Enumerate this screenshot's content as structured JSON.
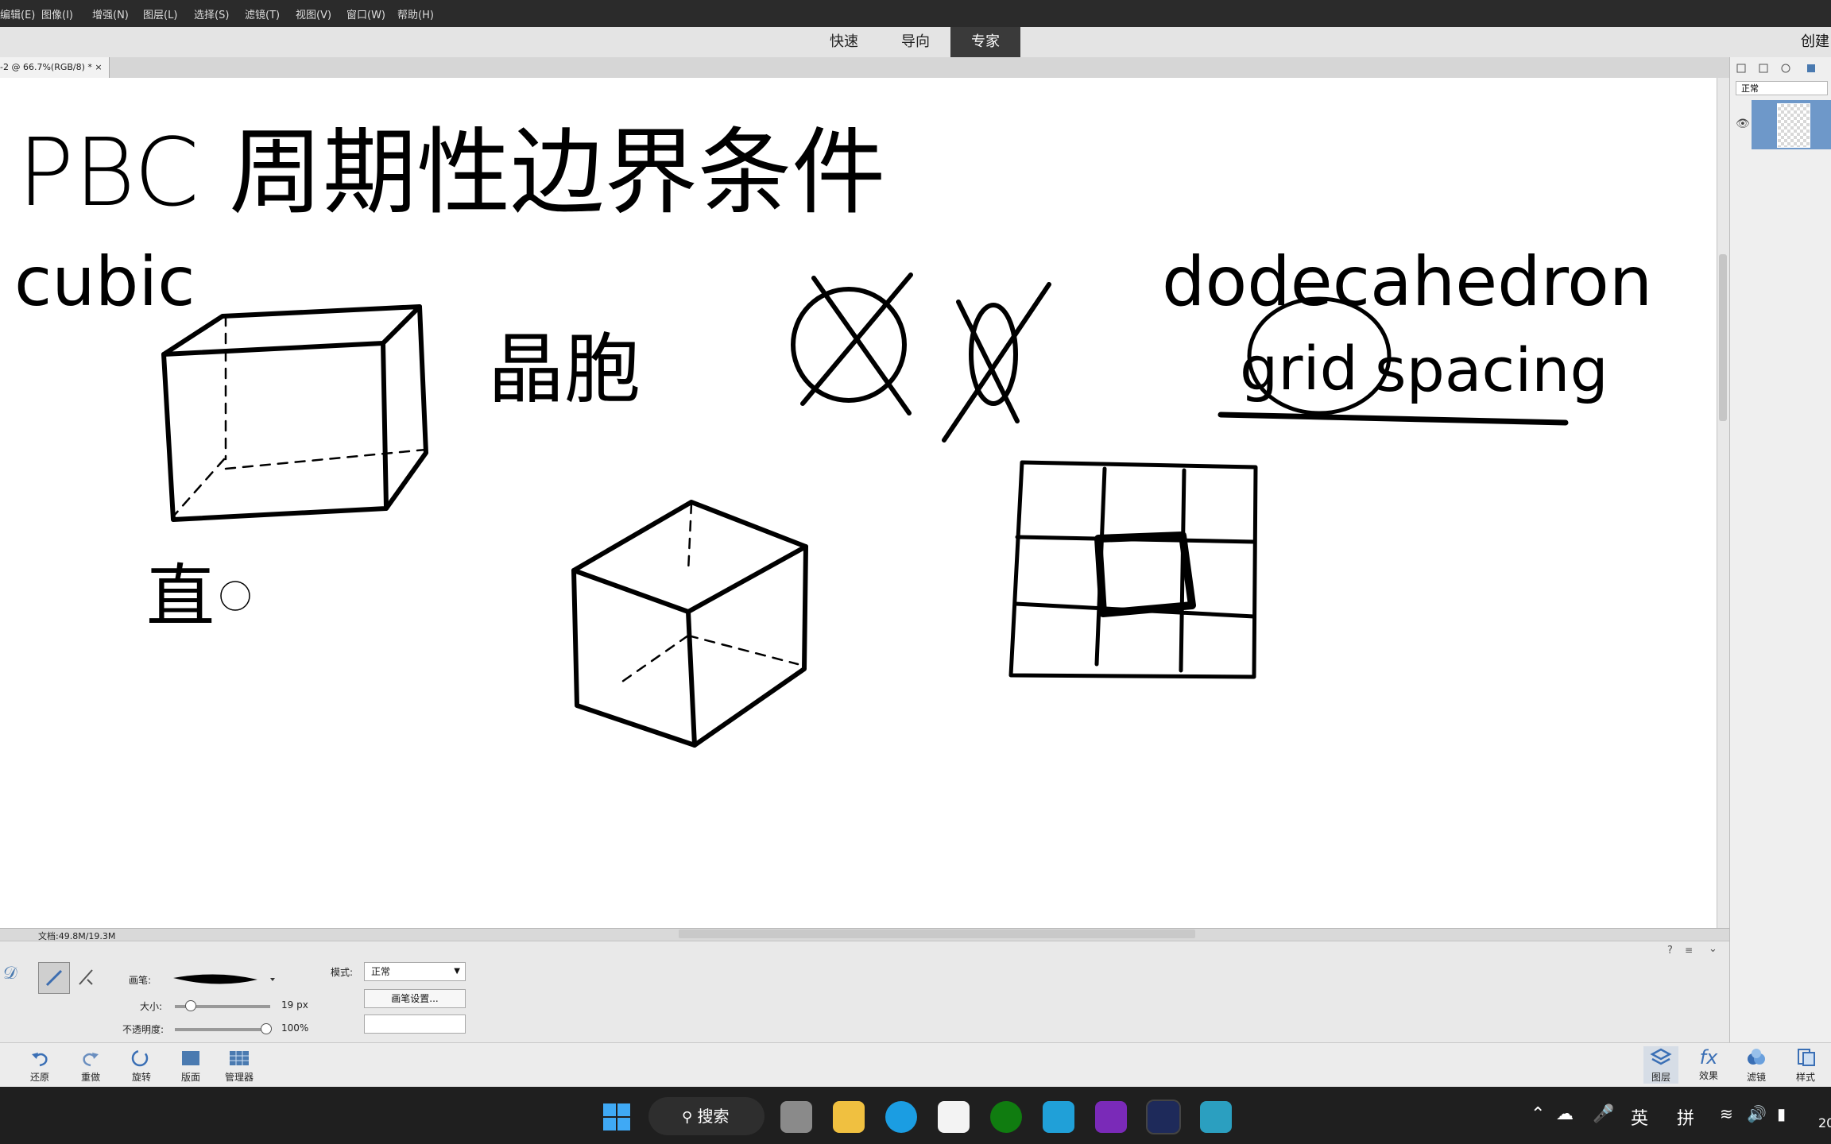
{
  "menu": [
    "编辑(E)",
    "图像(I)",
    "增强(N)",
    "图层(L)",
    "选择(S)",
    "滤镜(T)",
    "视图(V)",
    "窗口(W)",
    "帮助(H)"
  ],
  "modes": {
    "quick": "快速",
    "guided": "导向",
    "expert": "专家"
  },
  "create_label": "创建",
  "doc_tab": "-2 @ 66.7%(RGB/8) * ×",
  "status_doc": "文档:49.8M/19.3M",
  "layers_panel": {
    "blend_mode": "正常"
  },
  "canvas_text": {
    "title": "PBC 周期性边界条件",
    "cubic": "cubic",
    "crystal_cell": "晶胞",
    "dodecahedron": "dodecahedron",
    "grid": "grid",
    "spacing": "spacing",
    "partial": "直"
  },
  "tool_options": {
    "brush_label": "画笔:",
    "size_label": "大小:",
    "size_value": "19 px",
    "opacity_label": "不透明度:",
    "opacity_value": "100%",
    "mode_label": "模式:",
    "mode_value": "正常",
    "brush_settings": "画笔设置...",
    "size_level": 0.12,
    "opacity_level": 1.0
  },
  "bottom_bar": {
    "undo": "还原",
    "redo": "重做",
    "rotate": "旋转",
    "layout": "版面",
    "organizer": "管理器",
    "layers": "图层",
    "effects": "效果",
    "filters": "滤镜",
    "styles": "样式"
  },
  "taskbar": {
    "search": "搜索",
    "ime_lang": "英",
    "ime_mode": "拼",
    "clock_partial": "20"
  },
  "colors": {
    "accent": "#6e98c9",
    "menubar": "#2b2b2b",
    "taskbar": "#1f1f1f"
  }
}
